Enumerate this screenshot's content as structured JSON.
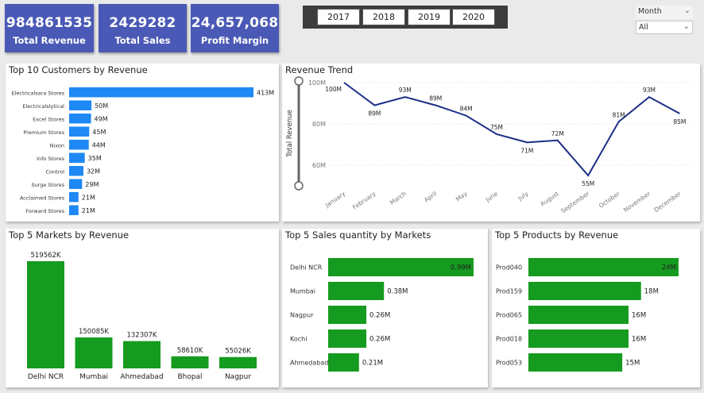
{
  "kpis": [
    {
      "value": "984861535",
      "label": "Total Revenue"
    },
    {
      "value": "2429282",
      "label": "Total Sales"
    },
    {
      "value": "24,657,068",
      "label": "Profit Margin"
    }
  ],
  "years": [
    "2017",
    "2018",
    "2019",
    "2020"
  ],
  "slicers": {
    "granularity": "Month",
    "filter_value": "All"
  },
  "colors": {
    "kpi": "#4a59b5",
    "customers_bar": "#1e88f5",
    "green": "#159b1f",
    "line": "#1c2e86"
  },
  "charts": [
    {
      "type": "bar",
      "title": "Top 10 Customers by Revenue",
      "categories": [
        "Electricalsara Stores",
        "Electricalslytical",
        "Excel Stores",
        "Premium Stores",
        "Nixon",
        "Info Stores",
        "Control",
        "Surge Stores",
        "Acclaimed Stores",
        "Forward Stores"
      ],
      "values": [
        413,
        50,
        49,
        45,
        44,
        35,
        32,
        29,
        21,
        21
      ],
      "labels": [
        "413M",
        "50M",
        "49M",
        "45M",
        "44M",
        "35M",
        "32M",
        "29M",
        "21M",
        "21M"
      ],
      "unit": "M"
    },
    {
      "type": "line",
      "title": "Revenue Trend",
      "ylabel": "Total Revenue",
      "categories": [
        "January",
        "February",
        "March",
        "April",
        "May",
        "June",
        "July",
        "August",
        "September",
        "October",
        "November",
        "December"
      ],
      "values": [
        100,
        89,
        93,
        89,
        84,
        75,
        71,
        72,
        55,
        81,
        93,
        85
      ],
      "labels": [
        "100M",
        "89M",
        "93M",
        "89M",
        "84M",
        "75M",
        "71M",
        "72M",
        "55M",
        "81M",
        "93M",
        "85M"
      ],
      "yticks": [
        "100M",
        "80M",
        "60M"
      ],
      "ylim": [
        50,
        100
      ]
    },
    {
      "type": "bar",
      "title": "Top 5 Markets by Revenue",
      "categories": [
        "Delhi NCR",
        "Mumbai",
        "Ahmedabad",
        "Bhopal",
        "Nagpur"
      ],
      "values": [
        519562,
        150085,
        132307,
        58610,
        55026
      ],
      "labels": [
        "519562K",
        "150085K",
        "132307K",
        "58610K",
        "55026K"
      ]
    },
    {
      "type": "bar",
      "title": "Top 5 Sales quantity by Markets",
      "categories": [
        "Delhi NCR",
        "Mumbai",
        "Nagpur",
        "Kochi",
        "Ahmedabad"
      ],
      "values": [
        0.99,
        0.38,
        0.26,
        0.26,
        0.21
      ],
      "labels": [
        "0.99M",
        "0.38M",
        "0.26M",
        "0.26M",
        "0.21M"
      ]
    },
    {
      "type": "bar",
      "title": "Top 5 Products by Revenue",
      "categories": [
        "Prod040",
        "Prod159",
        "Prod065",
        "Prod018",
        "Prod053"
      ],
      "values": [
        24,
        18,
        16,
        16,
        15
      ],
      "labels": [
        "24M",
        "18M",
        "16M",
        "16M",
        "15M"
      ]
    }
  ]
}
